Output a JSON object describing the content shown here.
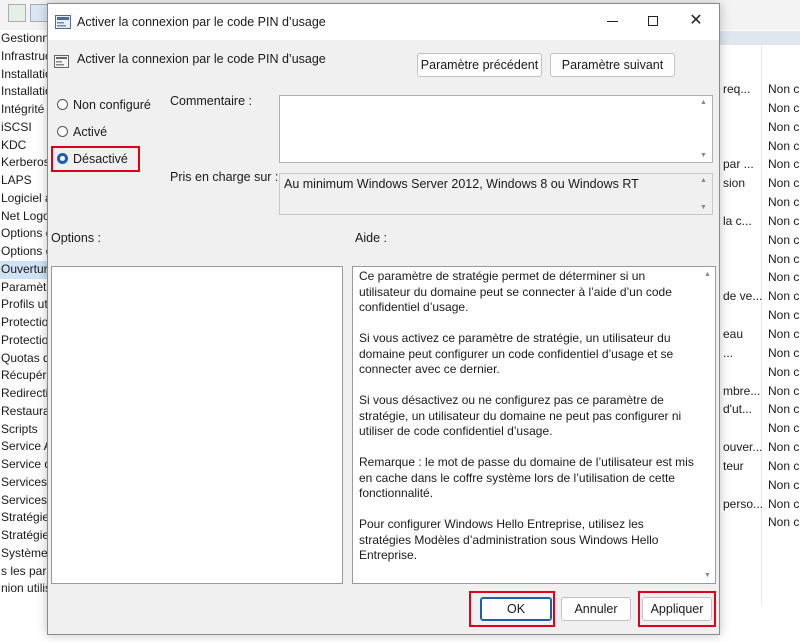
{
  "background": {
    "tree_items": [
      "Gestionn",
      "Infrastruc",
      "Installatio",
      "Installatio",
      "Intégrité",
      "iSCSI",
      "KDC",
      "Kerberos",
      "LAPS",
      "Logiciel a",
      "Net Logo",
      "Options d",
      "Options d",
      "Ouvertur",
      "Paramètr",
      "Profils ut",
      "Protectio",
      "Protectio",
      "Quotas d",
      "Récupéra",
      "Redirecti",
      "Restaurat",
      "Scripts",
      "Service A",
      "Service d",
      "Services",
      "Services",
      "Stratégie",
      "Stratégie",
      "Système",
      "s les para",
      "nion utilis"
    ],
    "right_rows": [
      {
        "c1": "req...",
        "c2": "Non c"
      },
      {
        "c1": "",
        "c2": "Non c"
      },
      {
        "c1": "",
        "c2": "Non c"
      },
      {
        "c1": "",
        "c2": "Non c"
      },
      {
        "c1": "par ...",
        "c2": "Non c"
      },
      {
        "c1": "sion",
        "c2": "Non c"
      },
      {
        "c1": "",
        "c2": "Non c"
      },
      {
        "c1": "la c...",
        "c2": "Non c"
      },
      {
        "c1": "",
        "c2": "Non c"
      },
      {
        "c1": "",
        "c2": "Non c"
      },
      {
        "c1": "",
        "c2": "Non c"
      },
      {
        "c1": "de ve...",
        "c2": "Non c"
      },
      {
        "c1": "",
        "c2": "Non c"
      },
      {
        "c1": "eau",
        "c2": "Non c"
      },
      {
        "c1": "...",
        "c2": "Non c"
      },
      {
        "c1": "",
        "c2": "Non c"
      },
      {
        "c1": "mbre...",
        "c2": "Non c"
      },
      {
        "c1": "d'ut...",
        "c2": "Non c"
      },
      {
        "c1": "",
        "c2": "Non c"
      },
      {
        "c1": "ouver...",
        "c2": "Non c"
      },
      {
        "c1": "teur",
        "c2": "Non c"
      },
      {
        "c1": "",
        "c2": "Non c"
      },
      {
        "c1": "perso...",
        "c2": "Non c"
      },
      {
        "c1": "",
        "c2": "Non c"
      }
    ]
  },
  "dialog": {
    "title": "Activer la connexion par le code PIN d’usage",
    "policy_name": "Activer la connexion par le code PIN d’usage",
    "prev_button": "Paramètre précédent",
    "next_button": "Paramètre suivant",
    "radio_not_configured": "Non configuré",
    "radio_enabled": "Activé",
    "radio_disabled": "Désactivé",
    "selected_option": "Désactivé",
    "comment_label": "Commentaire :",
    "comment_value": "",
    "supported_label": "Pris en charge sur :",
    "supported_value": "Au minimum Windows Server 2012, Windows 8 ou Windows RT",
    "options_label": "Options :",
    "help_label": "Aide :",
    "help_paragraphs": [
      "Ce paramètre de stratégie permet de déterminer si un utilisateur du domaine peut se connecter à l’aide d’un code confidentiel d’usage.",
      "Si vous activez ce paramètre de stratégie, un utilisateur du domaine peut configurer un code confidentiel d’usage et se connecter avec ce dernier.",
      "Si vous désactivez ou ne configurez pas ce paramètre de stratégie, un utilisateur du domaine ne peut pas configurer ni utiliser de code confidentiel d’usage.",
      "Remarque : le mot de passe du domaine de l’utilisateur est mis en cache dans le coffre système lors de l’utilisation de cette fonctionnalité.",
      "Pour configurer Windows Hello Entreprise, utilisez les stratégies Modèles d’administration sous Windows Hello Entreprise."
    ],
    "ok_button": "OK",
    "cancel_button": "Annuler",
    "apply_button": "Appliquer"
  },
  "colors": {
    "highlight_red": "#e0001b",
    "accent_blue": "#1c5fb1"
  }
}
